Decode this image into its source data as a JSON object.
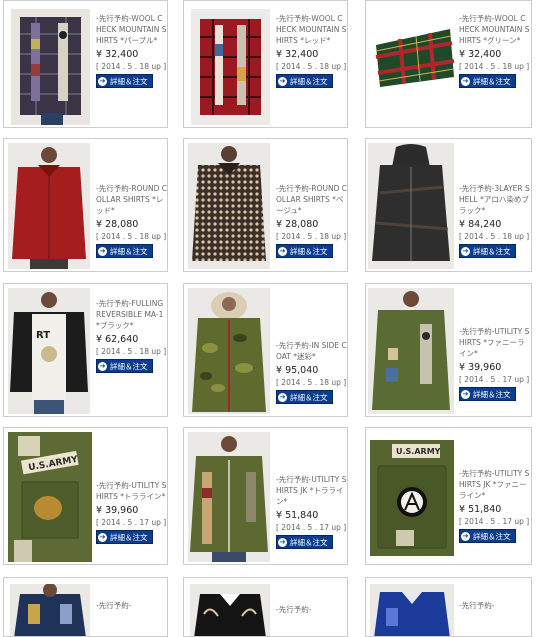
{
  "button_label": "詳細＆注文",
  "products": [
    {
      "title": "-先行予約-WOOL CHECK MOUNTAIN SHIRTS *パープル*",
      "price": "¥ 32,400",
      "date": "[ 2014 . 5 . 18 up ]",
      "image": "purple check mountain shirt with patchwork front"
    },
    {
      "title": "-先行予約-WOOL CHECK MOUNTAIN SHIRTS *レッド*",
      "price": "¥ 32,400",
      "date": "[ 2014 . 5 . 18 up ]",
      "image": "red check mountain shirt with patchwork front"
    },
    {
      "title": "-先行予約-WOOL CHECK MOUNTAIN SHIRTS *グリーン*",
      "price": "¥ 32,400",
      "date": "[ 2014 . 5 . 18 up ]",
      "image": "green and red tartan fabric detail"
    },
    {
      "title": "-先行予約-ROUND COLLAR SHIRTS *レッド*",
      "price": "¥ 28,080",
      "date": "[ 2014 . 5 . 18 up ]",
      "image": "red round collar shirt"
    },
    {
      "title": "-先行予約-ROUND COLLAR SHIRTS *ベージュ*",
      "price": "¥ 28,080",
      "date": "[ 2014 . 5 . 18 up ]",
      "image": "beige patterned round collar shirt"
    },
    {
      "title": "-先行予約-3LAYER SHELL *アロハ染めブラック*",
      "price": "¥ 84,240",
      "date": "[ 2014 . 5 . 18 up ]",
      "image": "black hooded shell jacket"
    },
    {
      "title": "-先行予約-FULLING REVERSIBLE MA-1 *ブラック*",
      "price": "¥ 62,640",
      "date": "[ 2014 . 5 . 18 up ]",
      "image": "black bomber jacket over graphic tee"
    },
    {
      "title": "-先行予約-IN SIDE COAT *迷彩*",
      "price": "¥ 95,040",
      "date": "[ 2014 . 5 . 18 up ]",
      "image": "camouflage coat with fur hood"
    },
    {
      "title": "-先行予約-UTILITY SHIRTS *ファニーライン*",
      "price": "¥ 39,960",
      "date": "[ 2014 . 5 . 17 up ]",
      "image": "olive utility shirt with patches"
    },
    {
      "title": "-先行予約-UTILITY SHIRTS *トラライン*",
      "price": "¥ 39,960",
      "date": "[ 2014 . 5 . 17 up ]",
      "image": "olive utility shirt pocket with US ARMY tag"
    },
    {
      "title": "-先行予約-UTILITY SHIRTS JK *トラライン*",
      "price": "¥ 51,840",
      "date": "[ 2014 . 5 . 17 up ]",
      "image": "olive utility jacket with zipper"
    },
    {
      "title": "-先行予約-UTILITY SHIRTS JK *ファニーライン*",
      "price": "¥ 51,840",
      "date": "[ 2014 . 5 . 17 up ]",
      "image": "olive utility jacket pocket with US ARMY tag"
    },
    {
      "title": "-先行予約-",
      "price": "",
      "date": "",
      "image": "navy souvenir jacket"
    },
    {
      "title": "-先行予約-",
      "price": "",
      "date": "",
      "image": "black embroidered souvenir jacket"
    },
    {
      "title": "-先行予約-",
      "price": "",
      "date": "",
      "image": "blue souvenir jacket"
    }
  ],
  "colors": {
    "button_bg": "#0b3d8f",
    "border": "#cccccc",
    "text": "#666666",
    "price": "#222222"
  }
}
